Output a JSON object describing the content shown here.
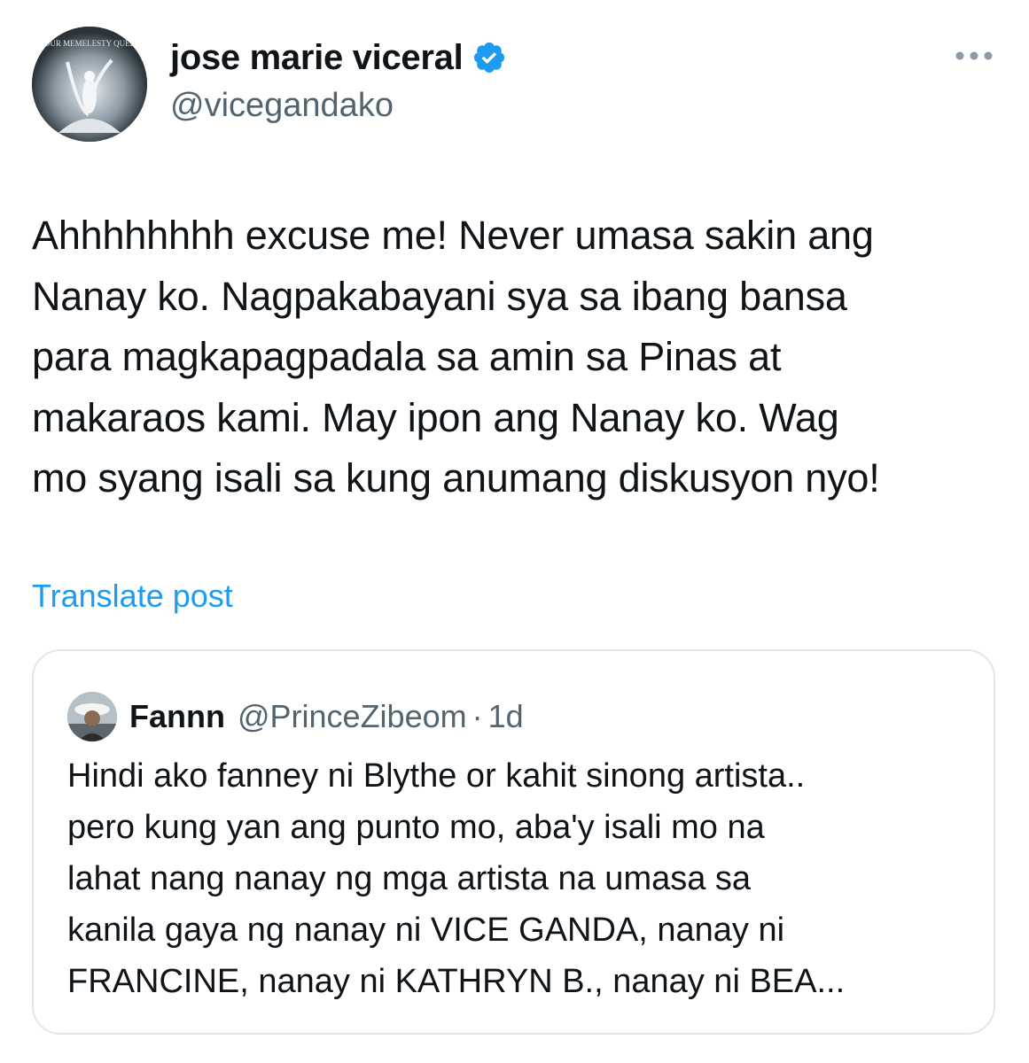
{
  "author": {
    "display_name": "jose marie viceral",
    "handle": "@vicegandako",
    "verified": true,
    "avatar_icon": "profile-avatar",
    "avatar_text": "YOUR MEMELESTY QUEEN"
  },
  "post": {
    "text": "Ahhhhhhhh excuse me! Never umasa sakin ang\nNanay ko. Nagpakabayani sya sa ibang bansa\npara magkapagpadala sa amin sa Pinas at\nmakaraos kami. May ipon ang Nanay ko. Wag\nmo syang isali sa kung anumang diskusyon nyo!",
    "translate_label": "Translate post"
  },
  "quoted": {
    "display_name": "Fannn",
    "handle": "@PrinceZibeom",
    "separator": "·",
    "time": "1d",
    "text": "Hindi ako fanney ni Blythe or kahit sinong artista..\npero kung yan ang punto mo, aba'y isali mo na\nlahat nang nanay ng mga artista na umasa sa\nkanila gaya ng nanay ni VICE GANDA, nanay ni\nFRANCINE, nanay ni KATHRYN B., nanay ni BEA..."
  },
  "colors": {
    "link": "#1d9bf0",
    "verified_badge": "#1d9bf0",
    "secondary_text": "#536471",
    "primary_text": "#0f1419",
    "border": "#e2e6ea"
  }
}
